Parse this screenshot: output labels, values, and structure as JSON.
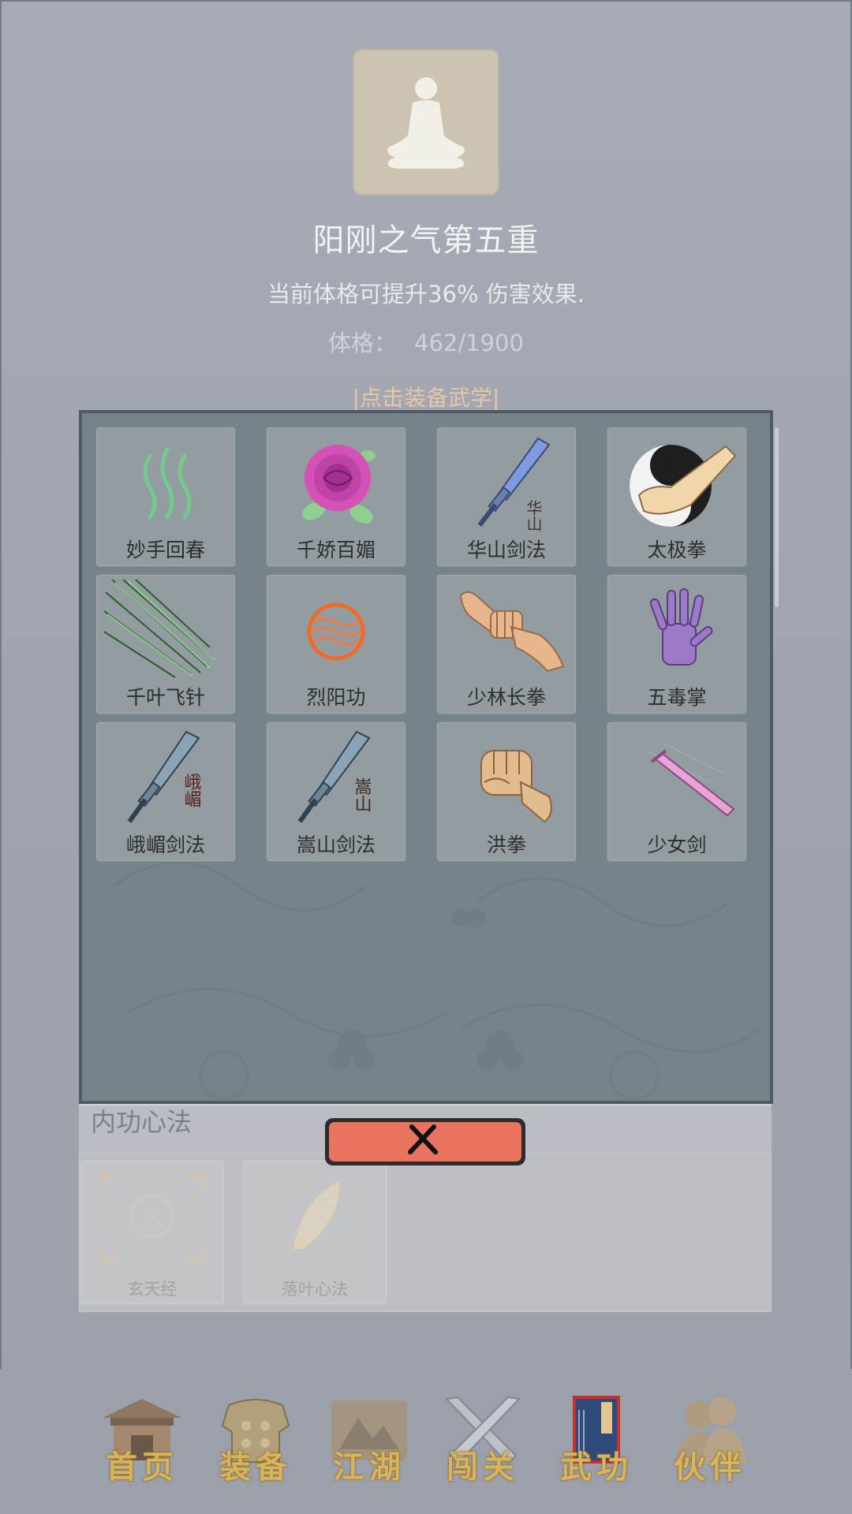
{
  "header": {
    "title": "阳刚之气第五重",
    "description": "当前体格可提升36% 伤害效果.",
    "stat_label": "体格：",
    "stat_value": "462/1900",
    "equip_hint": "|点击装备武学|"
  },
  "skills": [
    {
      "name": "妙手回春",
      "icon": "green-wisps-icon"
    },
    {
      "name": "千娇百媚",
      "icon": "rose-icon"
    },
    {
      "name": "华山剑法",
      "icon": "sword-huashan-icon",
      "glyph": "华山"
    },
    {
      "name": "太极拳",
      "icon": "taiji-fist-icon"
    },
    {
      "name": "千叶飞针",
      "icon": "flying-needles-icon"
    },
    {
      "name": "烈阳功",
      "icon": "sun-orb-icon"
    },
    {
      "name": "少林长拳",
      "icon": "shaolin-fists-icon"
    },
    {
      "name": "五毒掌",
      "icon": "poison-palm-icon"
    },
    {
      "name": "峨嵋剑法",
      "icon": "sword-emei-icon",
      "glyph": "峨嵋"
    },
    {
      "name": "嵩山剑法",
      "icon": "sword-songshan-icon",
      "glyph": "嵩山"
    },
    {
      "name": "洪拳",
      "icon": "fist-icon"
    },
    {
      "name": "少女剑",
      "icon": "pink-sword-icon"
    }
  ],
  "inner_arts": {
    "title": "内功心法",
    "items": [
      {
        "name": "玄天经",
        "icon": "xuan-scroll-icon",
        "glyph": "玄"
      },
      {
        "name": "落叶心法",
        "icon": "leaf-icon"
      }
    ]
  },
  "nav": [
    {
      "label": "首页",
      "icon": "temple-icon"
    },
    {
      "label": "装备",
      "icon": "armor-icon"
    },
    {
      "label": "江湖",
      "icon": "map-scroll-icon"
    },
    {
      "label": "闯关",
      "icon": "crossed-swords-icon"
    },
    {
      "label": "武功",
      "icon": "manual-book-icon"
    },
    {
      "label": "伙伴",
      "icon": "companions-icon"
    }
  ],
  "colors": {
    "background": "#9ea3ae",
    "panel": "#76838a",
    "card": "#939da1",
    "close_button": "#e9735f",
    "nav_label": "#d9b45c",
    "equip_hint": "#e6c7a6"
  }
}
